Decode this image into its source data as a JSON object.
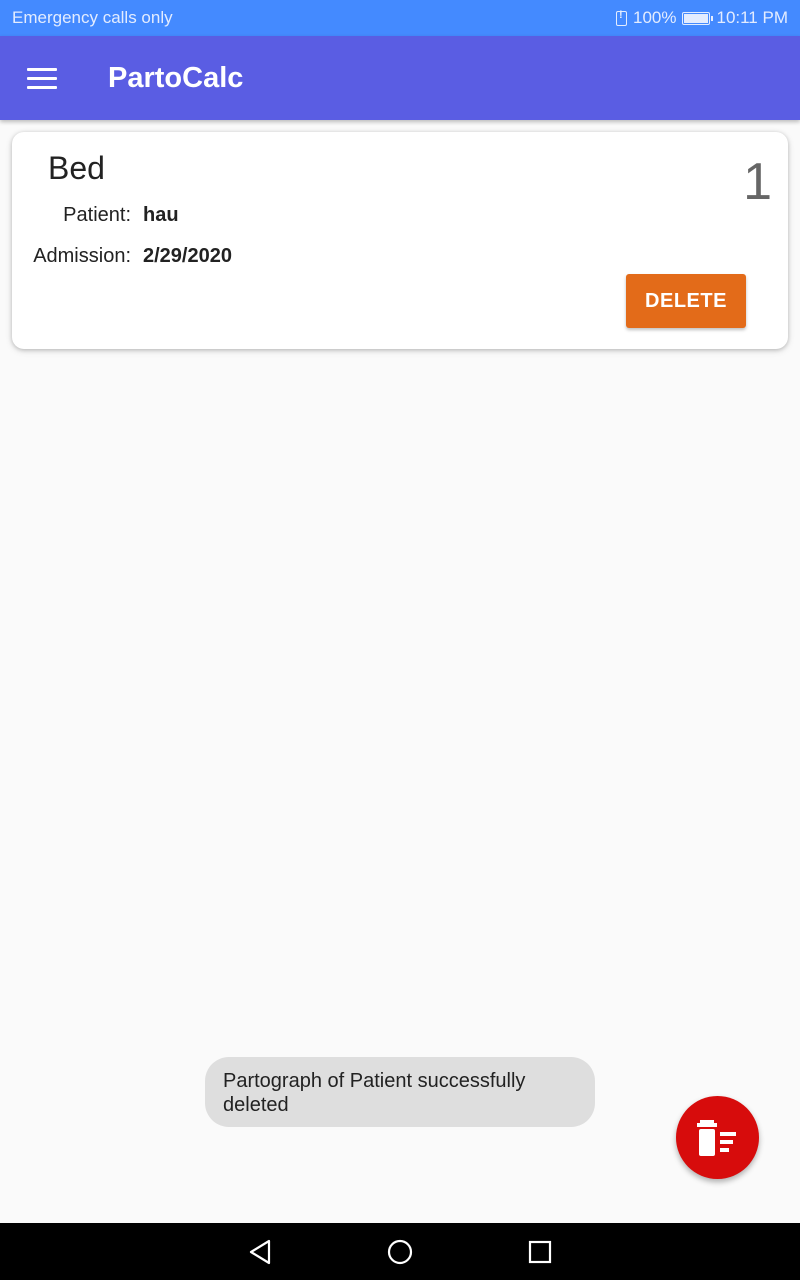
{
  "status_bar": {
    "carrier_text": "Emergency calls only",
    "battery": "100%",
    "time": "10:11 PM"
  },
  "app_bar": {
    "title": "PartoCalc",
    "menu_icon": "hamburger-menu-icon"
  },
  "bed_card": {
    "title": "Bed",
    "number": "1",
    "patient_label": "Patient:",
    "patient_value": "hau",
    "admission_label": "Admission:",
    "admission_value": "2/29/2020",
    "delete_label": "DELETE",
    "delete_color": "#e36b19"
  },
  "toast": {
    "message": "Partograph of Patient successfully deleted"
  },
  "fab": {
    "icon": "delete-sweep-icon",
    "color": "#d70c0c"
  },
  "nav_bar": {
    "back_icon": "back-triangle-icon",
    "home_icon": "home-circle-icon",
    "recents_icon": "recents-square-icon"
  },
  "colors": {
    "status_bar": "#448aff",
    "app_bar": "#5a5de3",
    "background": "#fafafa"
  }
}
